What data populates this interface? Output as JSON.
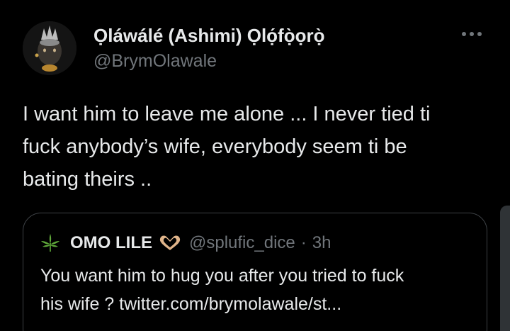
{
  "author": {
    "display_name": "Ọláwálé (Ashimi) Ọlọ́fọ̀ọrọ̀",
    "handle": "@BrymOlawale"
  },
  "tweet": {
    "lines": [
      "I want him to leave me alone ... I never tied ti",
      "fuck anybody’s wife, everybody seem ti be",
      "bating theirs .."
    ]
  },
  "quoted_tweet": {
    "display_name": "OMO LILE",
    "handle": "@splufic_dice",
    "separator": "·",
    "time": "3h",
    "lines": [
      "You want him to hug you after you tried to fuck",
      "his wife ? twitter.com/brymolawale/st..."
    ]
  },
  "icons": {
    "more": "more-horizontal-icon",
    "name_emoji_left": "leaf-icon",
    "name_emoji_right": "heart-hands-icon"
  },
  "colors": {
    "background": "#000000",
    "primary_text": "#e7e9ea",
    "secondary_text": "#71767b",
    "border": "#3d4145"
  }
}
